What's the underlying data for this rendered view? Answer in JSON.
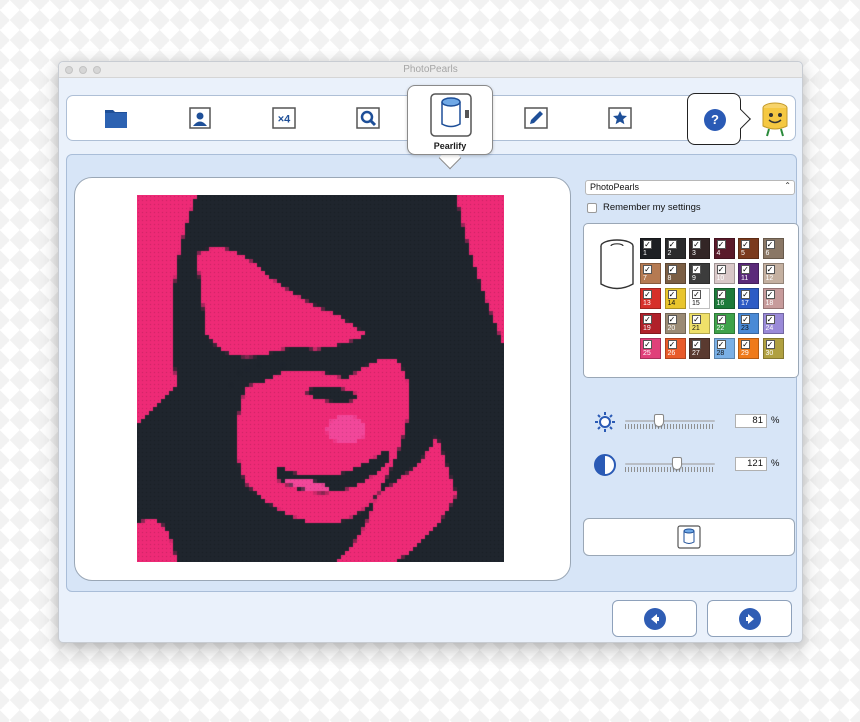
{
  "window": {
    "title": "PhotoPearls"
  },
  "toolbar": {
    "tools": [
      {
        "icon": "folder-icon"
      },
      {
        "icon": "portrait-icon"
      },
      {
        "icon": "multiply-icon",
        "label": "×4"
      },
      {
        "icon": "magnifier-icon"
      },
      {
        "icon": "pencil-icon"
      },
      {
        "icon": "star-icon"
      }
    ],
    "active_tab": {
      "label": "Pearlify",
      "icon": "pearl-jar-icon"
    },
    "help": {
      "label": "?"
    }
  },
  "settings": {
    "profile": "PhotoPearls",
    "remember_label": "Remember my settings"
  },
  "palette": {
    "colors": [
      {
        "n": "1",
        "hex": "#1d1f23",
        "text": "#ffffff"
      },
      {
        "n": "2",
        "hex": "#2b2b2c",
        "text": "#ffffff"
      },
      {
        "n": "3",
        "hex": "#332626",
        "text": "#ffffff"
      },
      {
        "n": "4",
        "hex": "#5a1a2a",
        "text": "#ffffff"
      },
      {
        "n": "5",
        "hex": "#7b3a1d",
        "text": "#ffffff"
      },
      {
        "n": "6",
        "hex": "#8a7765",
        "text": "#ffffff"
      },
      {
        "n": "7",
        "hex": "#b57a52",
        "text": "#ffffff"
      },
      {
        "n": "8",
        "hex": "#7b5e44",
        "text": "#ffffff"
      },
      {
        "n": "9",
        "hex": "#3c3c3c",
        "text": "#ffffff"
      },
      {
        "n": "10",
        "hex": "#d9c8c8",
        "text": "#ffffff"
      },
      {
        "n": "11",
        "hex": "#5b2a7a",
        "text": "#ffffff"
      },
      {
        "n": "12",
        "hex": "#c4b0a0",
        "text": "#ffffff"
      },
      {
        "n": "13",
        "hex": "#d6302a",
        "text": "#ffffff"
      },
      {
        "n": "14",
        "hex": "#e9c52c",
        "text": "#111111"
      },
      {
        "n": "15",
        "hex": "#ffffff",
        "text": "#111111"
      },
      {
        "n": "16",
        "hex": "#1d7a3a",
        "text": "#ffffff"
      },
      {
        "n": "17",
        "hex": "#2d5bc5",
        "text": "#ffffff"
      },
      {
        "n": "18",
        "hex": "#c79b9b",
        "text": "#ffffff"
      },
      {
        "n": "19",
        "hex": "#b0202a",
        "text": "#ffffff"
      },
      {
        "n": "20",
        "hex": "#9a8a74",
        "text": "#ffffff"
      },
      {
        "n": "21",
        "hex": "#efe06a",
        "text": "#111111"
      },
      {
        "n": "22",
        "hex": "#3ea24a",
        "text": "#ffffff"
      },
      {
        "n": "23",
        "hex": "#4a8ad6",
        "text": "#111111"
      },
      {
        "n": "24",
        "hex": "#9a8ad8",
        "text": "#ffffff"
      },
      {
        "n": "25",
        "hex": "#e0407a",
        "text": "#ffffff"
      },
      {
        "n": "26",
        "hex": "#e85a2a",
        "text": "#ffffff"
      },
      {
        "n": "27",
        "hex": "#5a3a30",
        "text": "#ffffff"
      },
      {
        "n": "28",
        "hex": "#7ab0e6",
        "text": "#111111"
      },
      {
        "n": "29",
        "hex": "#ef7a1a",
        "text": "#ffffff"
      },
      {
        "n": "30",
        "hex": "#b0a040",
        "text": "#ffffff"
      }
    ]
  },
  "adjustments": {
    "brightness": {
      "icon": "sun-icon",
      "value": "81",
      "unit": "%",
      "level": 0.38
    },
    "contrast": {
      "icon": "contrast-icon",
      "value": "121",
      "unit": "%",
      "level": 0.58
    }
  },
  "image": {
    "colors": {
      "dark": "#1f252d",
      "pink": "#ee2a76",
      "bright": "#f2479a"
    }
  },
  "navigation": {
    "back": {
      "icon": "arrow-left-icon"
    },
    "next": {
      "icon": "arrow-right-icon"
    }
  },
  "theme": {
    "accent": "#2f5db4",
    "panel": "#d7e5f7"
  }
}
